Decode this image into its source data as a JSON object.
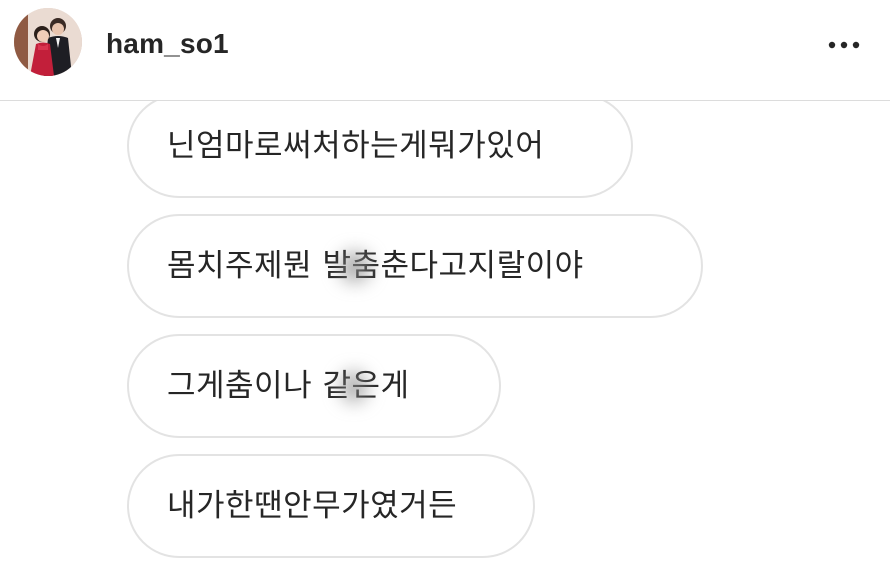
{
  "header": {
    "username": "ham_so1",
    "avatar_icon": "profile-photo",
    "menu_icon": "more-options-icon"
  },
  "messages": [
    {
      "text": "닌엄마로써처하는게뭐가있어"
    },
    {
      "text": "몸치주제뭔  발춤춘다고지랄이야",
      "censored": true
    },
    {
      "text": "그게춤이나  같은게",
      "censored": true
    },
    {
      "text": "내가한땐안무가였거든"
    }
  ],
  "colors": {
    "background": "#ffffff",
    "text": "#262626",
    "bubble_border": "#e3e3e3",
    "divider": "#dcdcdc"
  }
}
